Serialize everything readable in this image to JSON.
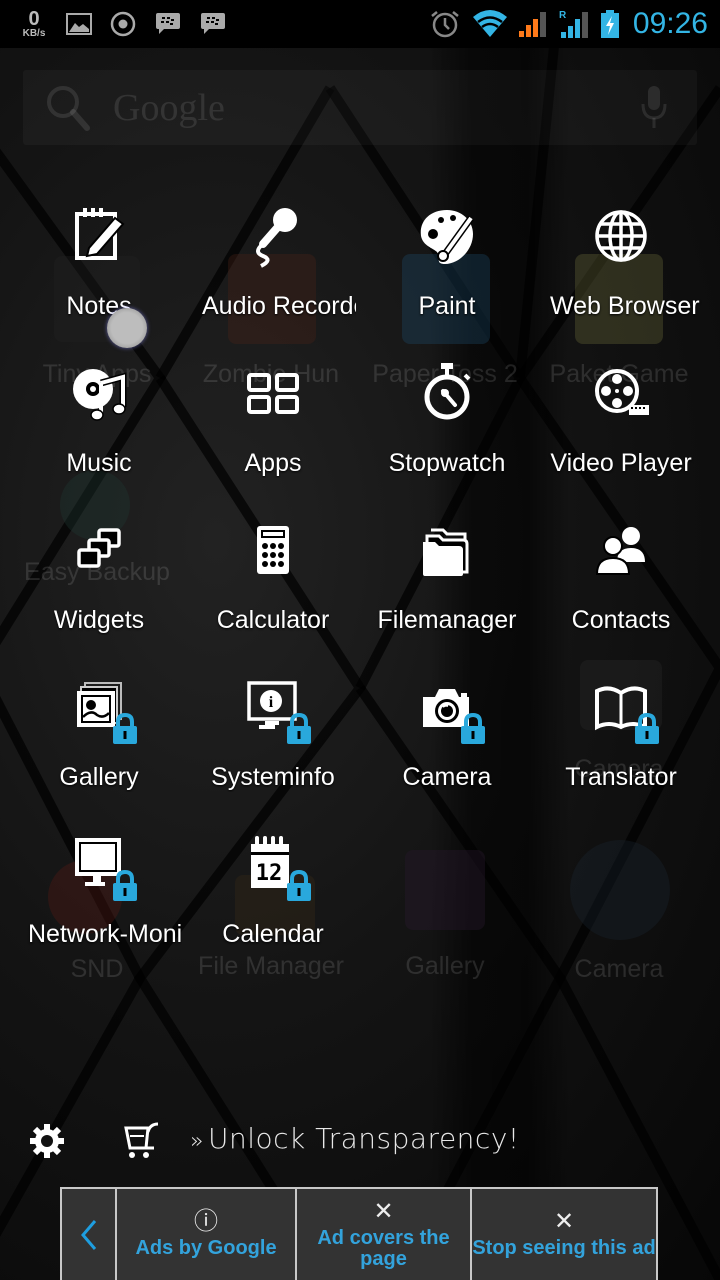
{
  "status_bar": {
    "network_speed_value": "0",
    "network_speed_unit": "KB/s",
    "left_icons": [
      "gallery-notification-icon",
      "record-icon",
      "bbm-icon",
      "bbm-icon"
    ],
    "right_icons": [
      "alarm-icon",
      "wifi-icon",
      "signal-icon-sim1",
      "signal-icon-sim2-roaming",
      "battery-charging-icon"
    ],
    "roaming_indicator": "R",
    "time": "09:26",
    "accent_color": "#33b5e5"
  },
  "search_widget": {
    "placeholder": "Google",
    "search_icon": "search-icon",
    "voice_icon": "mic-icon"
  },
  "background_home_icons": [
    {
      "label": "Tiny Apps"
    },
    {
      "label": "Zombie Hun"
    },
    {
      "label": "Paper Toss 2"
    },
    {
      "label": "Paket Game"
    },
    {
      "label": "Easy Backup"
    },
    {
      "label": "Camera"
    },
    {
      "label": "SND"
    },
    {
      "label": "File Manager"
    },
    {
      "label": "Gallery"
    },
    {
      "label": "Camera"
    }
  ],
  "apps": [
    {
      "label": "Notes",
      "icon": "notes-icon",
      "locked": false
    },
    {
      "label": "Audio Recorder",
      "icon": "microphone-icon",
      "locked": false
    },
    {
      "label": "Paint",
      "icon": "palette-icon",
      "locked": false
    },
    {
      "label": "Web Browser",
      "icon": "globe-icon",
      "locked": false
    },
    {
      "label": "Music",
      "icon": "music-icon",
      "locked": false
    },
    {
      "label": "Apps",
      "icon": "apps-grid-icon",
      "locked": false
    },
    {
      "label": "Stopwatch",
      "icon": "stopwatch-icon",
      "locked": false
    },
    {
      "label": "Video Player",
      "icon": "film-reel-icon",
      "locked": false
    },
    {
      "label": "Widgets",
      "icon": "widgets-icon",
      "locked": false
    },
    {
      "label": "Calculator",
      "icon": "calculator-icon",
      "locked": false
    },
    {
      "label": "Filemanager",
      "icon": "folder-icon",
      "locked": false
    },
    {
      "label": "Contacts",
      "icon": "contacts-icon",
      "locked": false
    },
    {
      "label": "Gallery",
      "icon": "gallery-icon",
      "locked": true
    },
    {
      "label": "Systeminfo",
      "icon": "system-info-icon",
      "locked": true
    },
    {
      "label": "Camera",
      "icon": "camera-icon",
      "locked": true
    },
    {
      "label": "Translator",
      "icon": "book-icon",
      "locked": true
    },
    {
      "label": "Network-Monitor",
      "icon": "monitor-icon",
      "locked": true
    },
    {
      "label": "Calendar",
      "icon": "calendar-icon",
      "locked": true
    }
  ],
  "calendar_day": "12",
  "bottom_bar": {
    "settings_icon": "gear-icon",
    "store_icon": "cart-icon",
    "promo_prefix": "»",
    "promo_text": "Unlock Transparency!"
  },
  "ad_overlay": {
    "back_glyph": "‹",
    "ads_by_label": "Ads by Google",
    "info_glyph": "ⓘ",
    "covers_label": "Ad covers the page",
    "stop_label": "Stop seeing this ad",
    "close_glyph": "✕",
    "text_color": "#33a3dc"
  }
}
